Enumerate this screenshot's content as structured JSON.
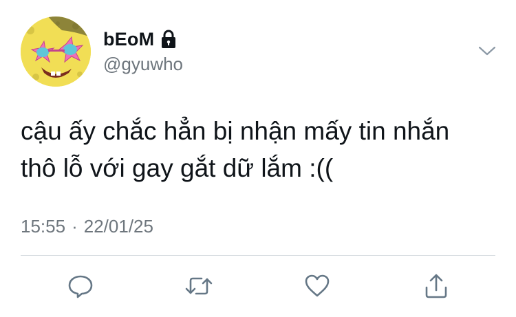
{
  "author": {
    "display_name": "bEoM",
    "handle": "@gyuwho",
    "avatar_icon": "spongebob-sunglasses-avatar",
    "protected_icon": "lock-icon"
  },
  "tweet": {
    "text": "cậu ấy chắc hẳn bị nhận mấy tin nhắn\nthô lỗ với gay gắt dữ lắm :((",
    "time": "15:55",
    "separator": "·",
    "date": "22/01/25"
  },
  "menu": {
    "icon": "chevron-down-icon"
  },
  "actions": {
    "reply_icon": "reply-icon",
    "retweet_icon": "retweet-icon",
    "like_icon": "heart-icon",
    "share_icon": "share-icon"
  },
  "colors": {
    "text_primary": "#0f1419",
    "text_secondary": "#6e767d",
    "icon": "#657786",
    "divider": "#d8dde1",
    "background": "#ffffff"
  }
}
